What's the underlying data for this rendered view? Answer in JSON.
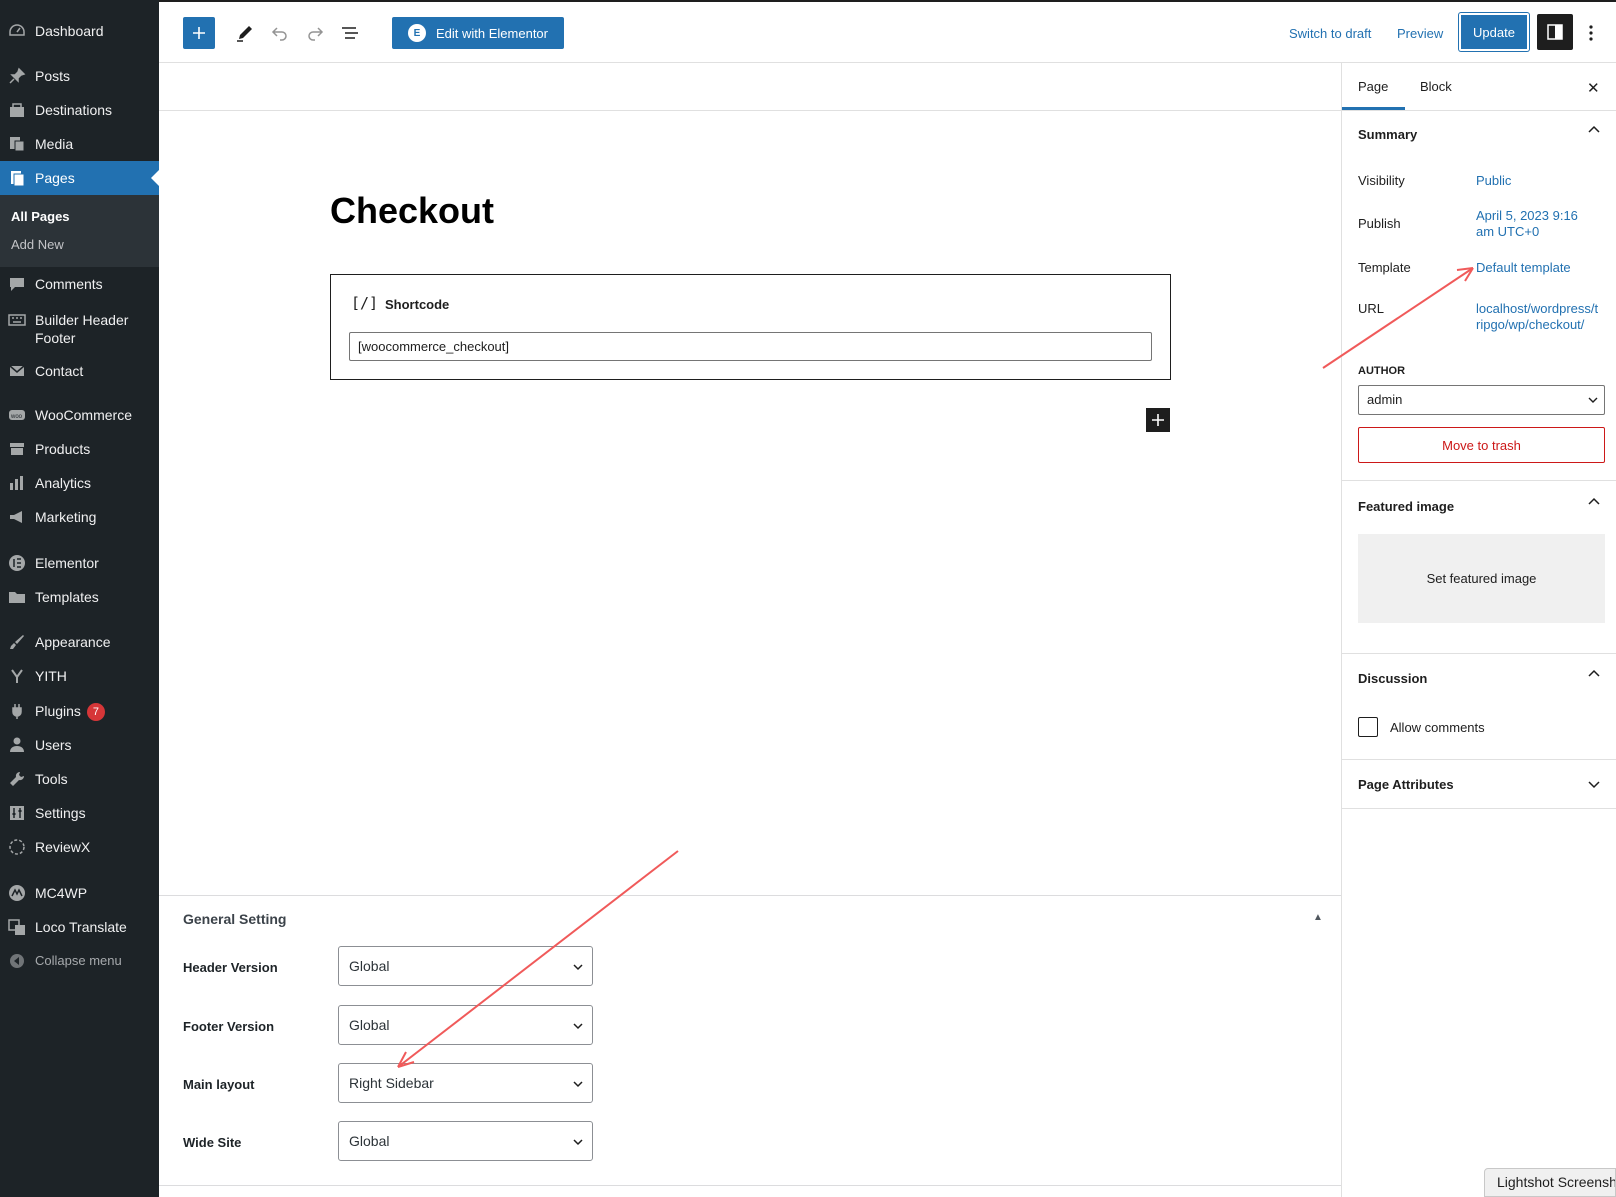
{
  "admin_menu": {
    "items": [
      {
        "label": "Dashboard",
        "icon": "dashboard-icon"
      },
      {
        "label": "Posts",
        "icon": "pin-icon"
      },
      {
        "label": "Destinations",
        "icon": "destinations-icon"
      },
      {
        "label": "Media",
        "icon": "media-icon"
      },
      {
        "label": "Pages",
        "icon": "pages-icon"
      },
      {
        "label": "Comments",
        "icon": "comment-icon"
      },
      {
        "label": "Builder Header Footer",
        "icon": "keyboard-icon"
      },
      {
        "label": "Contact",
        "icon": "mail-icon"
      },
      {
        "label": "WooCommerce",
        "icon": "woo-icon"
      },
      {
        "label": "Products",
        "icon": "archive-icon"
      },
      {
        "label": "Analytics",
        "icon": "bar-chart-icon"
      },
      {
        "label": "Marketing",
        "icon": "megaphone-icon"
      },
      {
        "label": "Elementor",
        "icon": "elementor-icon"
      },
      {
        "label": "Templates",
        "icon": "folder-icon"
      },
      {
        "label": "Appearance",
        "icon": "brush-icon"
      },
      {
        "label": "YITH",
        "icon": "yith-icon"
      },
      {
        "label": "Plugins",
        "icon": "plug-icon",
        "badge": "7"
      },
      {
        "label": "Users",
        "icon": "user-icon"
      },
      {
        "label": "Tools",
        "icon": "wrench-icon"
      },
      {
        "label": "Settings",
        "icon": "settings-icon"
      },
      {
        "label": "ReviewX",
        "icon": "reviewx-icon"
      },
      {
        "label": "MC4WP",
        "icon": "mc4wp-icon"
      },
      {
        "label": "Loco Translate",
        "icon": "translate-icon"
      }
    ],
    "submenu": {
      "all_pages": "All Pages",
      "add_new": "Add New"
    },
    "collapse": "Collapse menu"
  },
  "toolbar": {
    "edit_elementor": "Edit with Elementor",
    "switch_draft": "Switch to draft",
    "preview": "Preview",
    "update": "Update"
  },
  "editor": {
    "title": "Checkout",
    "block_name": "Shortcode",
    "block_icon": "[/]",
    "shortcode_value": "[woocommerce_checkout]"
  },
  "meta_box": {
    "title": "General Setting",
    "fields": [
      {
        "label": "Header Version",
        "value": "Global"
      },
      {
        "label": "Footer Version",
        "value": "Global"
      },
      {
        "label": "Main layout",
        "value": "Right Sidebar"
      },
      {
        "label": "Wide Site",
        "value": "Global"
      }
    ]
  },
  "sidebar": {
    "tabs": [
      "Page",
      "Block"
    ],
    "summary": {
      "heading": "Summary",
      "visibility_label": "Visibility",
      "visibility_value": "Public",
      "publish_label": "Publish",
      "publish_value": "April 5, 2023 9:16 am UTC+0",
      "template_label": "Template",
      "template_value": "Default template",
      "url_label": "URL",
      "url_value": "localhost/wordpress/tripgo/wp/checkout/",
      "author_label": "AUTHOR",
      "author_value": "admin",
      "trash": "Move to trash"
    },
    "featured": {
      "heading": "Featured image",
      "button": "Set featured image"
    },
    "discussion": {
      "heading": "Discussion",
      "allow": "Allow comments"
    },
    "attributes": {
      "heading": "Page Attributes"
    }
  },
  "overlay": {
    "lightshot": "Lightshot Screenshot"
  },
  "colors": {
    "admin_bg": "#1d2327",
    "accent": "#2271b1",
    "danger": "#cc1818",
    "annotation": "#f05a5a"
  }
}
